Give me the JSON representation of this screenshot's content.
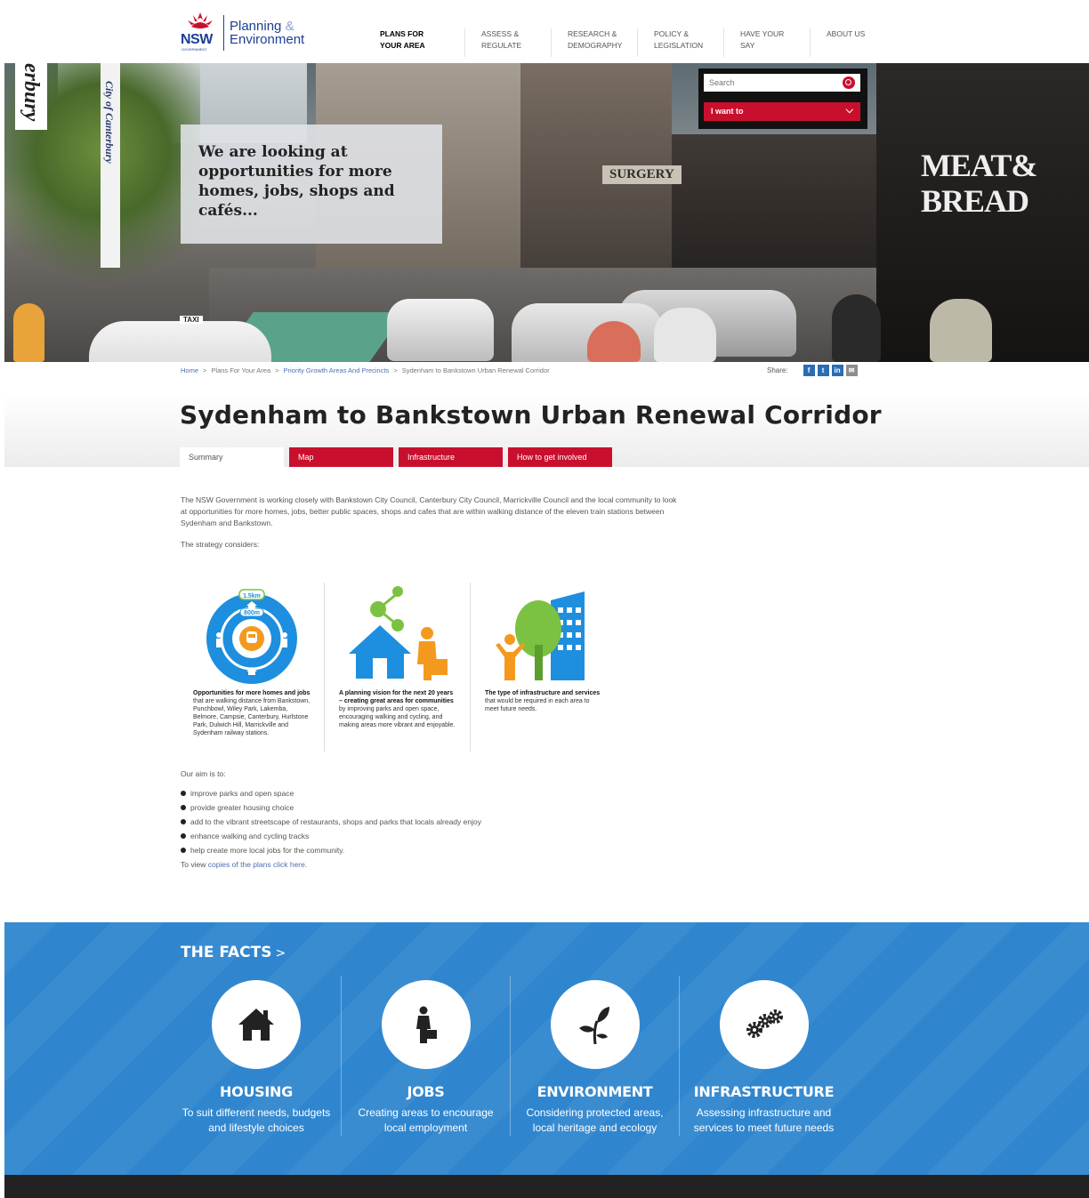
{
  "header": {
    "logo_nsw": "NSW",
    "logo_gov": "GOVERNMENT",
    "logo_line1": "Planning",
    "logo_amp": "&",
    "logo_line2": "Environment",
    "nav": [
      {
        "line1": "PLANS FOR",
        "line2": "YOUR AREA"
      },
      {
        "line1": "ASSESS &",
        "line2": "REGULATE"
      },
      {
        "line1": "RESEARCH &",
        "line2": "DEMOGRAPHY"
      },
      {
        "line1": "POLICY &",
        "line2": "LEGISLATION"
      },
      {
        "line1": "HAVE YOUR",
        "line2": "SAY"
      },
      {
        "line1": "ABOUT US",
        "line2": ""
      }
    ]
  },
  "hero": {
    "callout": "We are looking at opportunities for more homes, jobs, shops and cafés...",
    "search_placeholder": "Search",
    "i_want_to": "I want to",
    "sign_meat": "MEAT&",
    "sign_bread": "BREAD",
    "sign_surgery": "SURGERY",
    "sign_taxi": "TAXI",
    "pole_text": "City of Canterbury",
    "banner_text": "erbury"
  },
  "breadcrumb": {
    "home": "Home",
    "plans": "Plans For Your Area",
    "priority": "Priority Growth Areas And Precincts",
    "current": "Sydenham to Bankstown Urban Renewal Corridor",
    "sep": ">"
  },
  "share": {
    "label": "Share:",
    "facebook": "f",
    "twitter": "t",
    "linkedin": "in",
    "email": "✉"
  },
  "page": {
    "title": "Sydenham to Bankstown Urban Renewal Corridor",
    "tabs": [
      "Summary",
      "Map",
      "Infrastructure",
      "How to get involved"
    ],
    "intro": "The NSW Government is working closely with Bankstown City Council, Canterbury City Council, Marrickville Council and the local community to look at opportunities for more homes, jobs, better public spaces, shops and cafes that are within walking distance of the eleven train stations between Sydenham and Bankstown.",
    "strategy": "The strategy considers:",
    "info": [
      {
        "bold": "Opportunities for more homes and jobs",
        "rest": " that are walking distance from Bankstown, Punchbowl, Wiley Park, Lakemba, Belmore, Campsie, Canterbury, Hurlstone Park, Dulwich Hill, Marrickville and Sydenham railway stations."
      },
      {
        "bold": "A planning vision for the next 20 years – creating great areas for communities",
        "rest": " by improving parks and open space, encouraging walking and cycling, and making areas more vibrant and enjoyable."
      },
      {
        "bold": "The type of infrastructure and services",
        "rest": " that would be required in each area to meet future needs."
      }
    ],
    "label_15km": "1.5km",
    "label_800m": "800m",
    "aim": "Our aim is to:",
    "aims": [
      "improve parks and open space",
      "provide greater housing choice",
      "add to the vibrant streetscape of restaurants, shops and parks that locals already enjoy",
      "enhance walking and cycling tracks",
      "help create more local jobs for the community."
    ],
    "view_prefix": "To view ",
    "view_link": "copies of the plans click here",
    "view_suffix": "."
  },
  "facts": {
    "title": "THE FACTS",
    "chevron": ">",
    "items": [
      {
        "title": "HOUSING",
        "desc1": "To suit different needs, budgets",
        "desc2": "and lifestyle choices",
        "icon": "house-icon"
      },
      {
        "title": "JOBS",
        "desc1": "Creating areas to encourage",
        "desc2": "local employment",
        "icon": "worker-icon"
      },
      {
        "title": "ENVIRONMENT",
        "desc1": "Considering protected areas,",
        "desc2": "local heritage and ecology",
        "icon": "leaf-icon"
      },
      {
        "title": "INFRASTRUCTURE",
        "desc1": "Assessing infrastructure and",
        "desc2": "services to meet future needs",
        "icon": "gears-icon"
      }
    ]
  },
  "colors": {
    "brand_blue": "#1c3f94",
    "accent_red": "#c8102e",
    "facts_blue": "#2f86cf",
    "info_blue": "#1e8fde",
    "info_orange": "#f39a1e",
    "info_green": "#7cc242"
  }
}
